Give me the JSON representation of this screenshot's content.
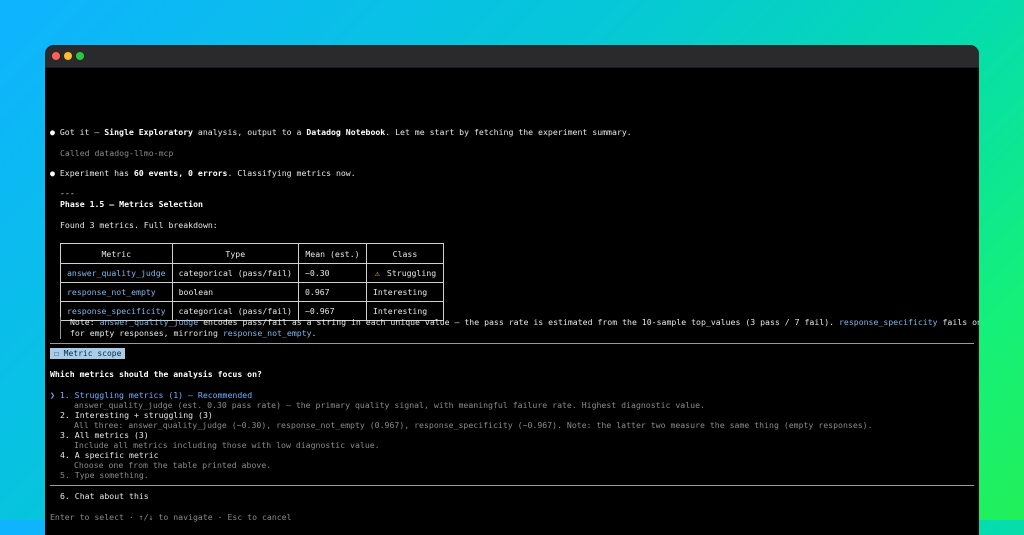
{
  "window": {
    "controls": [
      "close",
      "minimize",
      "maximize"
    ]
  },
  "messages": {
    "m1_pre": "Got it — ",
    "m1_bold1": "Single Exploratory",
    "m1_mid": " analysis, output to a ",
    "m1_bold2": "Datadog Notebook",
    "m1_post": ". Let me start by fetching the experiment summary.",
    "tool_call": "Called datadog-llmo-mcp",
    "m2_pre": "Experiment has ",
    "m2_bold": "60 events, 0 errors",
    "m2_post": ". Classifying metrics now.",
    "separator": "---",
    "phase_title": "Phase 1.5 — Metrics Selection",
    "found": "Found 3 metrics. Full breakdown:"
  },
  "table": {
    "headers": [
      "Metric",
      "Type",
      "Mean (est.)",
      "Class"
    ],
    "rows": [
      {
        "metric": "answer_quality_judge",
        "type": "categorical (pass/fail)",
        "mean": "~0.30",
        "class_icon": "warning-icon",
        "class": "Struggling"
      },
      {
        "metric": "response_not_empty",
        "type": "boolean",
        "mean": "0.967",
        "class": "Interesting"
      },
      {
        "metric": "response_specificity",
        "type": "categorical (pass/fail)",
        "mean": "~0.967",
        "class": "Interesting"
      }
    ]
  },
  "note": {
    "prefix": "Note: ",
    "metric1": "answer_quality_judge",
    "text1": " encodes pass/fail as a string in each unique value — the pass rate is estimated from the 10-sample top_values (3 pass / 7 fail). ",
    "metric2": "response_specificity",
    "text2": " fails only",
    "line2_pre": "for empty responses, mirroring ",
    "metric3": "response_not_empty",
    "line2_post": "."
  },
  "question": {
    "chip": "☐ Metric scope",
    "title": "Which metrics should the analysis focus on?",
    "cursor": "❯",
    "options": [
      {
        "label": "1. Struggling metrics (1) — Recommended",
        "desc": "answer_quality_judge (est. 0.30 pass rate) — the primary quality signal, with meaningful failure rate. Highest diagnostic value."
      },
      {
        "label": "2. Interesting + struggling (3)",
        "desc": "All three: answer_quality_judge (~0.30), response_not_empty (0.967), response_specificity (~0.967). Note: the latter two measure the same thing (empty responses)."
      },
      {
        "label": "3. All metrics (3)",
        "desc": "Include all metrics including those with low diagnostic value."
      },
      {
        "label": "4. A specific metric",
        "desc": "Choose one from the table printed above."
      },
      {
        "label": "5. Type something."
      }
    ],
    "chat": "6. Chat about this",
    "footer": "Enter to select · ↑/↓ to navigate · Esc to cancel"
  },
  "colors": {
    "accent": "#6fb0ff",
    "link": "#7fb5e8",
    "chip_bg": "#a9cde9",
    "warning": "#f5c518"
  }
}
